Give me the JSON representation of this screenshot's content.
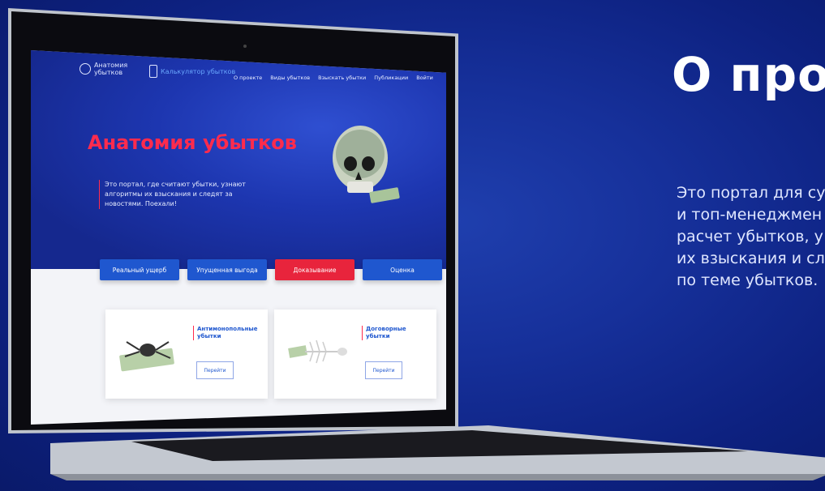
{
  "slide": {
    "title": "О про",
    "description_lines": [
      "Это портал для су",
      "и топ-менеджмен",
      "расчет убытков, у",
      "их взыскания и сл",
      "по теме убытков."
    ]
  },
  "site": {
    "logo_line1": "Анатомия",
    "logo_line2": "убытков",
    "calc_link": "Калькулятор убытков",
    "nav": [
      "О проекте",
      "Виды убытков",
      "Взыскать убытки",
      "Публикации",
      "Войти"
    ],
    "hero_title": "Анатомия убытков",
    "hero_text": "Это портал, где считают убытки, узнают алгоритмы их взыскания и следят за новостями. Поехали!",
    "buttons": [
      "Реальный ущерб",
      "Упущенная выгода",
      "Доказывание",
      "Оценка"
    ],
    "cards": [
      {
        "title": "Антимонопольные убытки",
        "button": "Перейти"
      },
      {
        "title": "Договорные убытки",
        "button": "Перейти"
      }
    ]
  },
  "colors": {
    "accent_red": "#ff2b4d",
    "accent_blue": "#1f57cf",
    "background": "#16309a"
  }
}
